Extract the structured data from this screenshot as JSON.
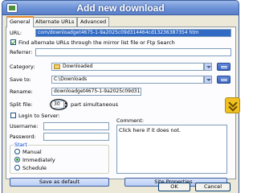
{
  "window": {
    "title": "Add new download"
  },
  "tabs": [
    {
      "label": "General",
      "active": true
    },
    {
      "label": "Alternate URLs"
    },
    {
      "label": "Advanced"
    }
  ],
  "general": {
    "url_label": "URL:",
    "url_value": "com/downloadget4675-1-9a2025c09d314464cd13236387354 htm",
    "find_alt_label": "Find alternate URLs through the mirror list file or Ftp Search",
    "find_alt_checked": true,
    "referrer_label": "Referrer:",
    "referrer_value": "",
    "category_label": "Category:",
    "category_value": "Downloaded",
    "save_to_label": "Save to:",
    "save_to_value": "C:\\Downloads",
    "rename_label": "Rename:",
    "rename_value": "downloadget4675-1-9a2025c09d31",
    "split_label": "Split file:",
    "split_value": "30",
    "split_suffix": "part simultaneous",
    "login_label": "Login to Server:",
    "login_checked": false,
    "username_label": "Username:",
    "password_label": "Password:",
    "comment_label": "Comment:",
    "comment_value": "Click here if it does not.",
    "start_group_label": "Start",
    "start_options": [
      {
        "label": "Manual",
        "selected": false
      },
      {
        "label": "Immediately",
        "selected": true
      },
      {
        "label": "Schedule",
        "selected": false
      }
    ],
    "save_default_label": "Save as default",
    "site_properties_label": "Site Properties..."
  },
  "footer": {
    "ok_label": "OK",
    "cancel_label": "Cancel"
  },
  "colors": {
    "titlebar": "#6b90d6",
    "accent": "#316ac5"
  }
}
